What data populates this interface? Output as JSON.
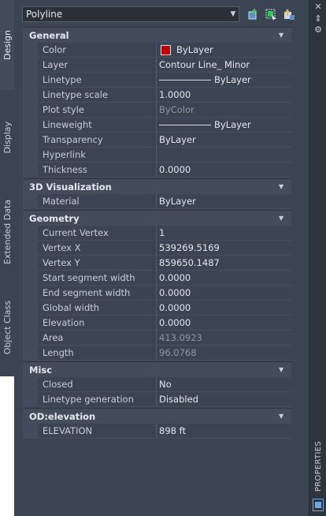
{
  "vertical_tabs": [
    {
      "label": "Design",
      "active": true
    },
    {
      "label": "Display",
      "active": false
    },
    {
      "label": "Extended Data",
      "active": false
    },
    {
      "label": "Object Class",
      "active": false
    }
  ],
  "object_selector": {
    "value": "Polyline"
  },
  "toolbar": {
    "icons": [
      "toggle-pickadd-icon",
      "select-objects-icon",
      "quick-select-icon"
    ]
  },
  "sections": {
    "general": {
      "title": "General",
      "color": {
        "label": "Color",
        "value": "ByLayer",
        "swatch": "#c00000"
      },
      "layer": {
        "label": "Layer",
        "value": "Contour Line_ Minor"
      },
      "linetype": {
        "label": "Linetype",
        "value": "ByLayer"
      },
      "linetype_scale": {
        "label": "Linetype scale",
        "value": "1.0000"
      },
      "plot_style": {
        "label": "Plot style",
        "value": "ByColor"
      },
      "lineweight": {
        "label": "Lineweight",
        "value": "ByLayer"
      },
      "transparency": {
        "label": "Transparency",
        "value": "ByLayer"
      },
      "hyperlink": {
        "label": "Hyperlink",
        "value": ""
      },
      "thickness": {
        "label": "Thickness",
        "value": "0.0000"
      }
    },
    "viz3d": {
      "title": "3D Visualization",
      "material": {
        "label": "Material",
        "value": "ByLayer"
      }
    },
    "geometry": {
      "title": "Geometry",
      "current_vertex": {
        "label": "Current Vertex",
        "value": "1"
      },
      "vertex_x": {
        "label": "Vertex X",
        "value": "539269.5169"
      },
      "vertex_y": {
        "label": "Vertex Y",
        "value": "859650.1487"
      },
      "start_width": {
        "label": "Start segment width",
        "value": "0.0000"
      },
      "end_width": {
        "label": "End segment width",
        "value": "0.0000"
      },
      "global_width": {
        "label": "Global width",
        "value": "0.0000"
      },
      "elevation": {
        "label": "Elevation",
        "value": "0.0000"
      },
      "area": {
        "label": "Area",
        "value": "413.0923"
      },
      "length": {
        "label": "Length",
        "value": "96.0768"
      }
    },
    "misc": {
      "title": "Misc",
      "closed": {
        "label": "Closed",
        "value": "No"
      },
      "linetype_generation": {
        "label": "Linetype generation",
        "value": "Disabled"
      }
    },
    "od_elevation": {
      "title": "OD:elevation",
      "elevation": {
        "label": "ELEVATION",
        "value": "898 ft"
      }
    }
  },
  "palette": {
    "title": "PROPERTIES"
  },
  "colors": {
    "panel": "#3b4453",
    "header": "#434c5b",
    "accent_green": "#3fbf5f",
    "accent_blue": "#6fa8dc"
  }
}
